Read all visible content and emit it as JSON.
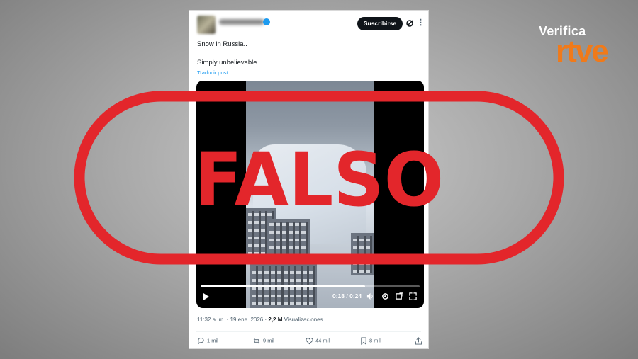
{
  "brand": {
    "verifica": "Verifica",
    "rtve": "rtve",
    "accent": "#f07a1a"
  },
  "tweet": {
    "subscribe_label": "Suscribirse",
    "line1": "Snow in Russia..",
    "line2": "Simply unbelievable.",
    "translate_label": "Traducir post",
    "video": {
      "time_label": "0:18 / 0:24",
      "progress_fraction": 0.75
    },
    "time": "11:32 a. m.",
    "date": "19 ene. 2026",
    "views": "2,2 M",
    "views_label": "Visualizaciones",
    "actions": {
      "replies": "1 mil",
      "reposts": "9 mil",
      "likes": "44 mil",
      "bookmarks": "8 mil"
    }
  },
  "stamp": {
    "text": "FALSO",
    "color": "#e3262b"
  }
}
